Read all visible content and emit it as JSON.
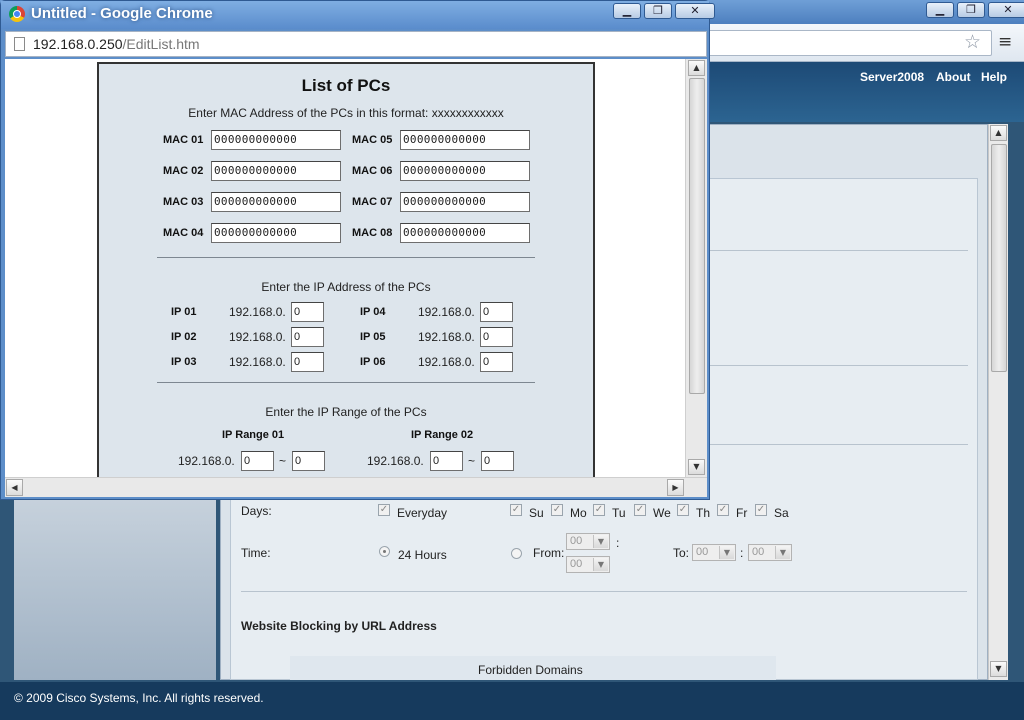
{
  "background_window": {
    "nav": {
      "server": "Server2008",
      "about": "About",
      "help": "Help"
    },
    "controls": {
      "minimize": "▁",
      "maximize": "❐",
      "close": "✕"
    },
    "footer": "© 2009 Cisco Systems, Inc. All rights reserved.",
    "days": {
      "label": "Days:",
      "everyday": "Everyday",
      "items": [
        "Su",
        "Mo",
        "Tu",
        "We",
        "Th",
        "Fr",
        "Sa"
      ]
    },
    "time": {
      "label": "Time:",
      "hours24": "24 Hours",
      "from": "From:",
      "to": "To:",
      "colon": ":",
      "from_hour": "00",
      "from_min": "00",
      "to_hour": "00",
      "to_min": "00"
    },
    "url_block_title": "Website Blocking by URL Address",
    "forbidden_domains": "Forbidden Domains"
  },
  "popup": {
    "title": "Untitled - Google Chrome",
    "controls": {
      "minimize": "▁",
      "maximize": "❐",
      "close": "✕"
    },
    "url_host": "192.168.0.250",
    "url_path": "/EditList.htm",
    "heading": "List of PCs",
    "mac_instructions": "Enter MAC Address of the PCs in this format: xxxxxxxxxxxx",
    "mac": [
      {
        "label": "MAC 01",
        "value": "000000000000"
      },
      {
        "label": "MAC 02",
        "value": "000000000000"
      },
      {
        "label": "MAC 03",
        "value": "000000000000"
      },
      {
        "label": "MAC 04",
        "value": "000000000000"
      },
      {
        "label": "MAC 05",
        "value": "000000000000"
      },
      {
        "label": "MAC 06",
        "value": "000000000000"
      },
      {
        "label": "MAC 07",
        "value": "000000000000"
      },
      {
        "label": "MAC 08",
        "value": "000000000000"
      }
    ],
    "ip_instructions": "Enter the IP Address of the PCs",
    "ip_prefix": "192.168.0.",
    "ip": [
      {
        "label": "IP 01",
        "value": "0"
      },
      {
        "label": "IP 02",
        "value": "0"
      },
      {
        "label": "IP 03",
        "value": "0"
      },
      {
        "label": "IP 04",
        "value": "0"
      },
      {
        "label": "IP 05",
        "value": "0"
      },
      {
        "label": "IP 06",
        "value": "0"
      }
    ],
    "range_instructions": "Enter the IP Range of the PCs",
    "ranges": [
      {
        "label": "IP Range 01",
        "start": "0",
        "end": "0"
      },
      {
        "label": "IP Range 02",
        "start": "0",
        "end": "0"
      }
    ],
    "range_sep": "~"
  },
  "icons": {
    "star": "☆",
    "menu": "≡",
    "scroll_up": "▲",
    "scroll_down": "▼",
    "scroll_left": "◀",
    "scroll_right": "▶",
    "check": "✓",
    "select_arrow": "▼"
  }
}
